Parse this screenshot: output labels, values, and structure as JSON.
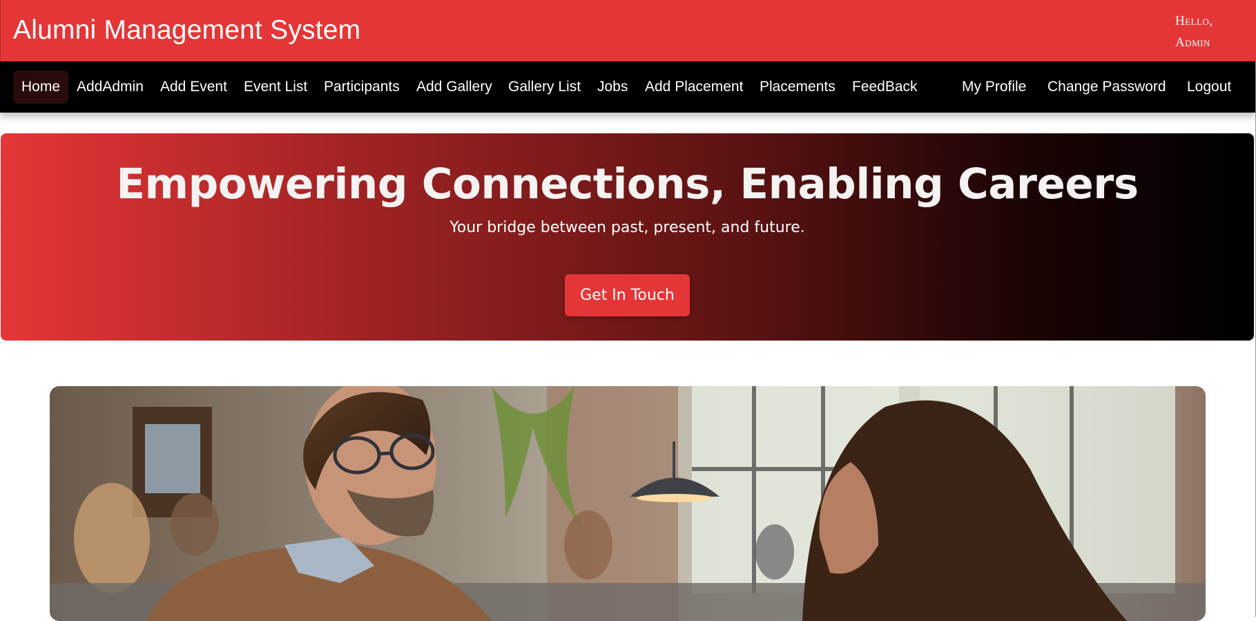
{
  "header": {
    "brand": "Alumni Management System",
    "greeting_line1": "Hello,",
    "greeting_line2": "Admin"
  },
  "nav": {
    "left": [
      "Home",
      "AddAdmin",
      "Add Event",
      "Event List",
      "Participants",
      "Add Gallery",
      "Gallery List",
      "Jobs",
      "Add Placement",
      "Placements",
      "FeedBack"
    ],
    "right": [
      "My Profile",
      "Change Password",
      "Logout"
    ],
    "active": "Home"
  },
  "hero": {
    "title": "Empowering Connections, Enabling Careers",
    "subtitle": "Your bridge between past, present, and future.",
    "button": "Get In Touch"
  },
  "carousel": {
    "image": "mentor-conversation-photo"
  },
  "colors": {
    "primary": "#e53637",
    "nav_bg": "#000000",
    "active_nav_bg": "#2a0b0b"
  }
}
